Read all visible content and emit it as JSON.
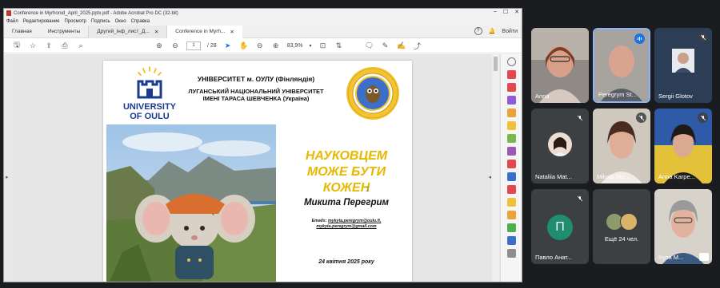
{
  "acrobat": {
    "window_title": "Conference in Myrhorod_April_2025.pptx.pdf - Adobe Acrobat Pro DC (32-bit)",
    "menu": [
      "Файл",
      "Редактирование",
      "Просмотр",
      "Подпись",
      "Окно",
      "Справка"
    ],
    "tabs": {
      "home": "Главная",
      "tools": "Инструменты",
      "doc1": "Другий_інф_лист_Д...",
      "doc2": "Conference in Myrh..."
    },
    "signin": "Войти",
    "page_current": "1",
    "page_total": "/ 28",
    "zoom": "83,9%"
  },
  "slide": {
    "oulu_logo_line1": "UNIVERSITY",
    "oulu_logo_line2": "OF OULU",
    "uni_line1": "УНІВЕРСИТЕТ м. ОУЛУ (Фінляндія)",
    "uni_line2": "ЛУГАНСЬКИЙ НАЦІОНАЛЬНИЙ УНІВЕРСИТЕТ",
    "uni_line3": "ІМЕНІ ТАРАСА ШЕВЧЕНКА (Україна)",
    "title_l1": "НАУКОВЦЕМ",
    "title_l2": "МОЖЕ БУТИ",
    "title_l3": "КОЖЕН",
    "author": "Микита Перегрим",
    "emails_label": "Emails:",
    "email1": "mykyta.peregrym@oulu.fi,",
    "email2": "mykyta.peregrym@gmail.com",
    "date": "24 квітня 2025 року"
  },
  "participants": [
    {
      "name": "Anna",
      "muted": false
    },
    {
      "name": "Peregrym St...",
      "muted": false,
      "speaking": true
    },
    {
      "name": "Sergii Glotov",
      "muted": true
    },
    {
      "name": "Nataliia Mat...",
      "muted": true
    },
    {
      "name": "Mikola Ste...",
      "muted": true
    },
    {
      "name": "Anna Karpe...",
      "muted": true
    },
    {
      "name": "Павло Анат...",
      "muted": true,
      "initial": "П"
    },
    {
      "name": "Ещё 24 чел."
    },
    {
      "name": "Iryna M...",
      "muted": false
    }
  ],
  "colors": {
    "accent_title": "#e6b800",
    "oulu_blue": "#1a3a8f",
    "speaker_blue": "#1a73e8",
    "avatar_green": "#1e8e6e"
  }
}
